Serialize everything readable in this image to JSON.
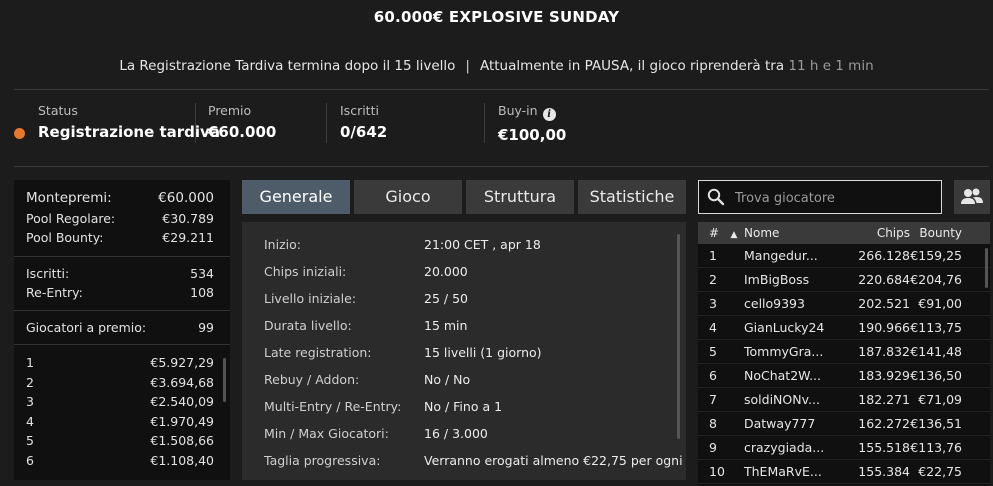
{
  "header": {
    "title": "60.000€ EXPLOSIVE SUNDAY",
    "notice_left": "La Registrazione Tardiva termina dopo il 15 livello",
    "notice_sep": "|",
    "notice_right": "Attualmente in PAUSA, il gioco riprenderà tra",
    "notice_time": "11 h e 1 min"
  },
  "stats": {
    "status_label": "Status",
    "status_value": "Registrazione tardiva",
    "status_color": "#e8772b",
    "prize_label": "Premio",
    "prize_value": "€60.000",
    "entries_label": "Iscritti",
    "entries_value": "0/642",
    "buyin_label": "Buy-in",
    "buyin_value": "€100,00",
    "buyin_icon": "info-icon"
  },
  "prize_panel": {
    "totals": [
      {
        "label": "Montepremi:",
        "value": "€60.000"
      },
      {
        "label": "Pool Regolare:",
        "value": "€30.789"
      },
      {
        "label": "Pool Bounty:",
        "value": "€29.211"
      }
    ],
    "counts": [
      {
        "label": "Iscritti:",
        "value": "534"
      },
      {
        "label": "Re-Entry:",
        "value": "108"
      }
    ],
    "paid": {
      "label": "Giocatori a premio:",
      "value": "99"
    },
    "places": [
      {
        "pos": "1",
        "amount": "€5.927,29"
      },
      {
        "pos": "2",
        "amount": "€3.694,68"
      },
      {
        "pos": "3",
        "amount": "€2.540,09"
      },
      {
        "pos": "4",
        "amount": "€1.970,49"
      },
      {
        "pos": "5",
        "amount": "€1.508,66"
      },
      {
        "pos": "6",
        "amount": "€1.108,40"
      }
    ]
  },
  "tabs": [
    "Generale",
    "Gioco",
    "Struttura",
    "Statistiche"
  ],
  "details": [
    {
      "label": "Inizio:",
      "value": "21:00 CET , apr 18"
    },
    {
      "label": "Chips iniziali:",
      "value": "20.000"
    },
    {
      "label": "Livello iniziale:",
      "value": "25 / 50"
    },
    {
      "label": "Durata livello:",
      "value": "15 min"
    },
    {
      "label": "Late registration:",
      "value": "15 livelli (1 giorno)"
    },
    {
      "label": "Rebuy / Addon:",
      "value": "No / No"
    },
    {
      "label": "Multi-Entry / Re-Entry:",
      "value": "No / Fino a 1"
    },
    {
      "label": "Min / Max Giocatori:",
      "value": "16 / 3.000"
    },
    {
      "label": "Taglia progressiva:",
      "value": "Verranno erogati almeno €22,75 per ogni"
    }
  ],
  "search": {
    "placeholder": "Trova giocatore",
    "icon": "search-icon"
  },
  "players_button_icon": "users-icon",
  "player_table": {
    "headers": {
      "num": "#",
      "sort": "▲",
      "name": "Nome",
      "chips": "Chips",
      "bounty": "Bounty"
    },
    "rows": [
      {
        "n": "1",
        "name": "Mangedur...",
        "chips": "266.128",
        "bounty": "€159,25"
      },
      {
        "n": "2",
        "name": "ImBigBoss",
        "chips": "220.684",
        "bounty": "€204,76"
      },
      {
        "n": "3",
        "name": "cello9393",
        "chips": "202.521",
        "bounty": "€91,00"
      },
      {
        "n": "4",
        "name": "GianLucky24",
        "chips": "190.966",
        "bounty": "€113,75"
      },
      {
        "n": "5",
        "name": "TommyGra...",
        "chips": "187.832",
        "bounty": "€141,48"
      },
      {
        "n": "6",
        "name": "NoChat2W...",
        "chips": "183.929",
        "bounty": "€136,50"
      },
      {
        "n": "7",
        "name": "soldiNONv...",
        "chips": "182.271",
        "bounty": "€71,09"
      },
      {
        "n": "8",
        "name": "Datway777",
        "chips": "162.272",
        "bounty": "€136,51"
      },
      {
        "n": "9",
        "name": "crazygiada...",
        "chips": "155.518",
        "bounty": "€113,76"
      },
      {
        "n": "10",
        "name": "ThEMaRvE...",
        "chips": "155.384",
        "bounty": "€22,75"
      }
    ]
  }
}
